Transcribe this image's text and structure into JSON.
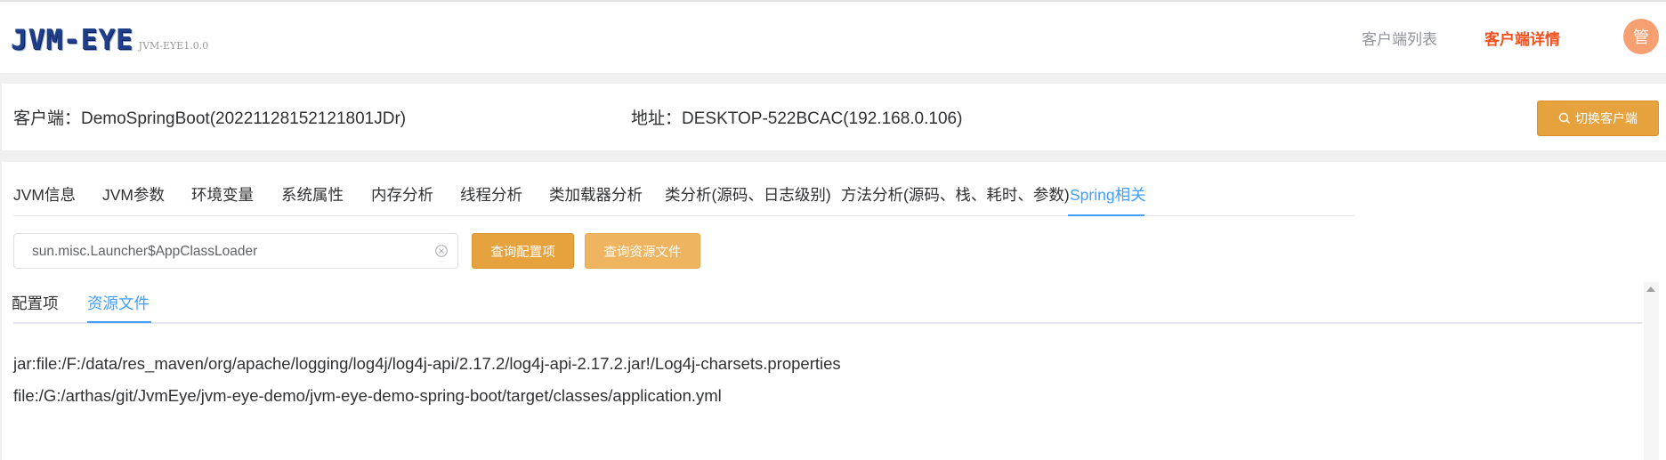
{
  "header": {
    "logo_text": "JVM-EYE",
    "logo_version": "JVM-EYE1.0.0",
    "nav": [
      "客户端列表",
      "客户端详情"
    ],
    "avatar_char": "管"
  },
  "client": {
    "name": "客户端：DemoSpringBoot(20221128152121801JDr)",
    "address": "地址：DESKTOP-522BCAC(192.168.0.106)",
    "switch_label": "切换客户端"
  },
  "tabs": [
    "JVM信息",
    "JVM参数",
    "环境变量",
    "系统属性",
    "内存分析",
    "线程分析",
    "类加载器分析",
    "类分析(源码、日志级别)",
    "方法分析(源码、栈、耗时、参数)",
    "Spring相关"
  ],
  "active_tab": "Spring相关",
  "search": {
    "value": "sun.misc.Launcher$AppClassLoader"
  },
  "buttons": {
    "query_config": "查询配置项",
    "query_resource": "查询资源文件"
  },
  "subtabs": [
    "配置项",
    "资源文件"
  ],
  "active_subtab": "资源文件",
  "resources": [
    "jar:file:/F:/data/res_maven/org/apache/logging/log4j/log4j-api/2.17.2/log4j-api-2.17.2.jar!/Log4j-charsets.properties",
    "file:/G:/arthas/git/JvmEye/jvm-eye-demo/jvm-eye-demo-spring-boot/target/classes/application.yml"
  ],
  "colors": {
    "accent_orange": "#e6a23c",
    "active_blue": "#409eff",
    "nav_active_red": "#f4511e",
    "avatar": "#f6a071"
  }
}
